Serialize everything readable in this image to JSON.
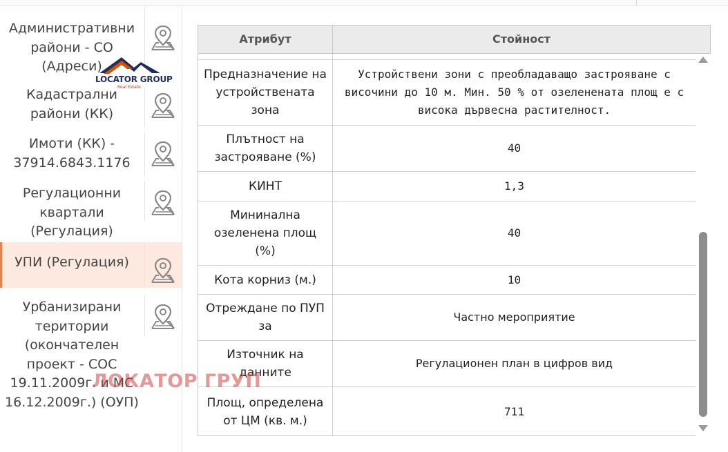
{
  "sidebar": {
    "items": [
      {
        "label": "Административни райони - СО (Адреси)",
        "icon": "map-pin-icon"
      },
      {
        "label": "Кадастрални райони (КК)",
        "icon": "map-pin-icon"
      },
      {
        "label": "Имоти (КК) - 37914.6843.1176",
        "icon": "map-pin-icon"
      },
      {
        "label": "Регулационни квартали (Регулация)",
        "icon": "map-pin-icon"
      },
      {
        "label": "УПИ (Регулация)",
        "icon": "map-pin-icon",
        "active": true
      },
      {
        "label": "Урбанизирани територии (окончателен проект - СОС 19.11.2009г. и МС 16.12.2009г.) (ОУП)",
        "icon": "map-pin-icon"
      }
    ]
  },
  "logo": {
    "name": "LOCATOR GROUP",
    "sub": "Real Estate"
  },
  "watermark": "ЛОКАТОР ГРУП",
  "table": {
    "headers": {
      "attribute": "Атрибут",
      "value": "Стойност"
    },
    "rows": [
      {
        "attribute": "Предназначение на устройствената зона",
        "value": "Устройствени зони с преобладаващо застрояване с височини до 10 м. Мин. 50 % от озеленената площ е с висока дървесна растителност."
      },
      {
        "attribute": "Плътност на застрояване (%)",
        "value": "40"
      },
      {
        "attribute": "КИНТ",
        "value": "1,3"
      },
      {
        "attribute": "Мининална озеленена площ (%)",
        "value": "40"
      },
      {
        "attribute": "Кота корниз (м.)",
        "value": "10"
      },
      {
        "attribute": "Отреждане по ПУП за",
        "value": "Частно мероприятие"
      },
      {
        "attribute": "Източник на данните",
        "value": "Регулационен план в цифров вид"
      },
      {
        "attribute": "Площ, определена от ЦМ (кв. м.)",
        "value": "711"
      }
    ]
  },
  "colors": {
    "accent": "#e8834f",
    "active_bg": "#fde9df",
    "header_bg": "#ebebeb"
  }
}
